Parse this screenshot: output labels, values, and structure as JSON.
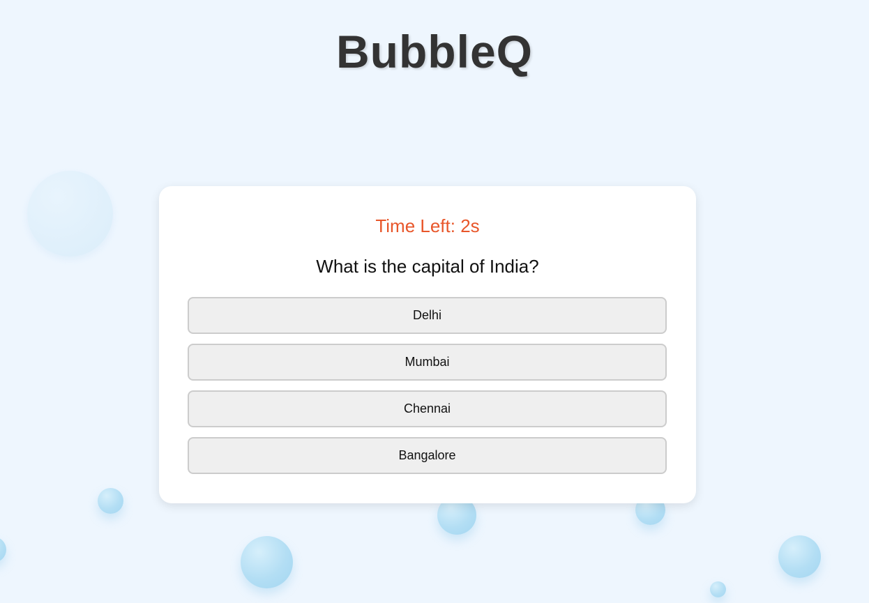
{
  "app": {
    "title": "BubbleQ"
  },
  "quiz": {
    "timer_text": "Time Left: 2s",
    "question": "What is the capital of India?",
    "options": [
      {
        "label": "Delhi"
      },
      {
        "label": "Mumbai"
      },
      {
        "label": "Chennai"
      },
      {
        "label": "Bangalore"
      }
    ]
  },
  "colors": {
    "background": "#eef6fe",
    "title": "#333333",
    "timer": "#e8562a",
    "card": "#ffffff",
    "option_bg": "#efefef",
    "option_border": "#cccccc",
    "bubble": "#b3def4"
  }
}
